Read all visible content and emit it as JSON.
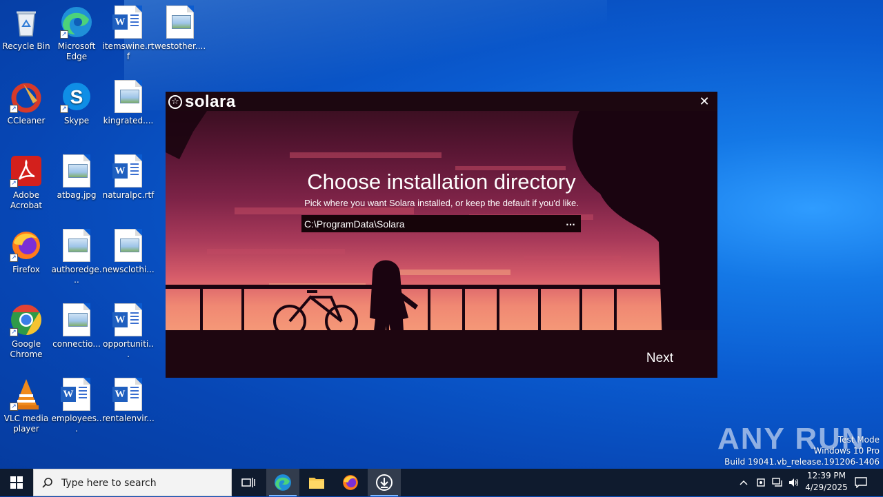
{
  "desktop": {
    "icons": [
      {
        "label": "Recycle Bin",
        "icon": "recycle-bin-icon"
      },
      {
        "label": "Microsoft Edge",
        "icon": "edge-icon"
      },
      {
        "label": "itemswine.rtf",
        "icon": "word-doc-icon"
      },
      {
        "label": "westother....",
        "icon": "image-file-icon"
      },
      {
        "label": "CCleaner",
        "icon": "ccleaner-icon"
      },
      {
        "label": "Skype",
        "icon": "skype-icon"
      },
      {
        "label": "kingrated....",
        "icon": "image-file-icon"
      },
      {
        "label": "Adobe Acrobat",
        "icon": "acrobat-icon"
      },
      {
        "label": "atbag.jpg",
        "icon": "image-file-icon"
      },
      {
        "label": "naturalpc.rtf",
        "icon": "word-doc-icon"
      },
      {
        "label": "Firefox",
        "icon": "firefox-icon"
      },
      {
        "label": "authoredge...",
        "icon": "image-file-icon"
      },
      {
        "label": "newsclothi...",
        "icon": "image-file-icon"
      },
      {
        "label": "Google Chrome",
        "icon": "chrome-icon"
      },
      {
        "label": "connectio...",
        "icon": "image-file-icon"
      },
      {
        "label": "opportuniti...",
        "icon": "word-doc-icon"
      },
      {
        "label": "VLC media player",
        "icon": "vlc-icon"
      },
      {
        "label": "employees...",
        "icon": "word-doc-icon"
      },
      {
        "label": "rentalenvir...",
        "icon": "word-doc-icon"
      }
    ]
  },
  "installer": {
    "brand": "solara",
    "heading": "Choose installation directory",
    "subheading": "Pick where you want Solara installed, or keep the default if you'd like.",
    "path_value": "C:\\ProgramData\\Solara",
    "browse_label": "...",
    "next_label": "Next",
    "close_glyph": "✕"
  },
  "watermark": {
    "brand": "ANY RUN",
    "line1": "Test Mode",
    "line2": "Windows 10 Pro",
    "line3": "Build 19041.vb_release.191206-1406"
  },
  "taskbar": {
    "search_placeholder": "Type here to search",
    "time": "12:39 PM",
    "date": "4/29/2025"
  },
  "colors": {
    "accent": "#0a5bd0",
    "installer_bg": "#1e0610",
    "taskbar_bg": "#0f1b2e"
  }
}
